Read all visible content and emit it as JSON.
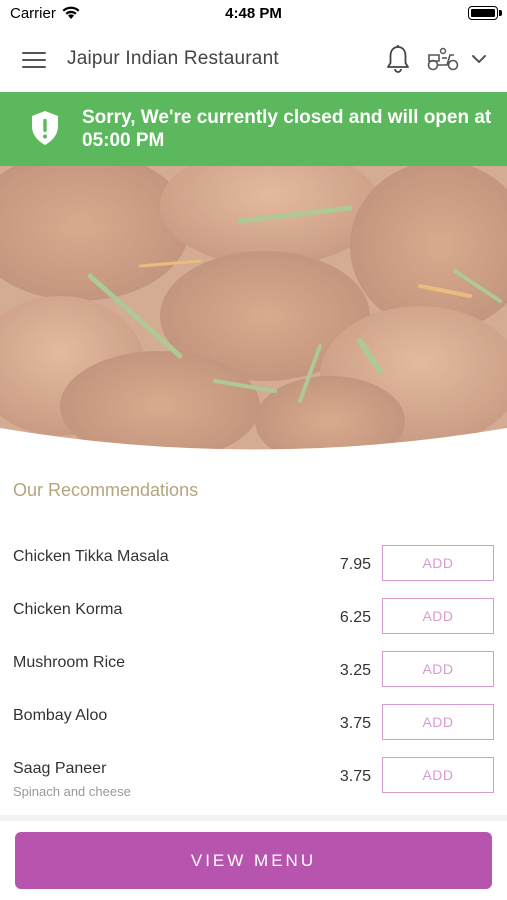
{
  "status_bar": {
    "carrier": "Carrier",
    "time": "4:48 PM",
    "icons": [
      "wifi-icon",
      "battery-icon"
    ]
  },
  "header": {
    "title": "Jaipur Indian Restaurant",
    "icons": [
      "hamburger-menu-icon",
      "bell-icon",
      "scooter-icon",
      "chevron-down-icon"
    ]
  },
  "banner": {
    "message": "Sorry, We're currently closed and will open at 05:00 PM",
    "icon": "shield-alert-icon",
    "color": "#5cb85c"
  },
  "hero": {
    "image": "food photo of chicken curry pieces with herbs"
  },
  "recommendations": {
    "heading": "Our Recommendations",
    "add_label": "ADD",
    "items": [
      {
        "name": "Chicken Tikka Masala",
        "price": "7.95",
        "description": ""
      },
      {
        "name": "Chicken Korma",
        "price": "6.25",
        "description": ""
      },
      {
        "name": "Mushroom Rice",
        "price": "3.25",
        "description": ""
      },
      {
        "name": "Bombay Aloo",
        "price": "3.75",
        "description": ""
      },
      {
        "name": "Saag Paneer",
        "price": "3.75",
        "description": "Spinach and cheese"
      }
    ]
  },
  "footer": {
    "view_menu_label": "VIEW MENU"
  },
  "colors": {
    "accent": "#b654ae",
    "add_border": "#d69bd3",
    "heading": "#b5a47e"
  }
}
